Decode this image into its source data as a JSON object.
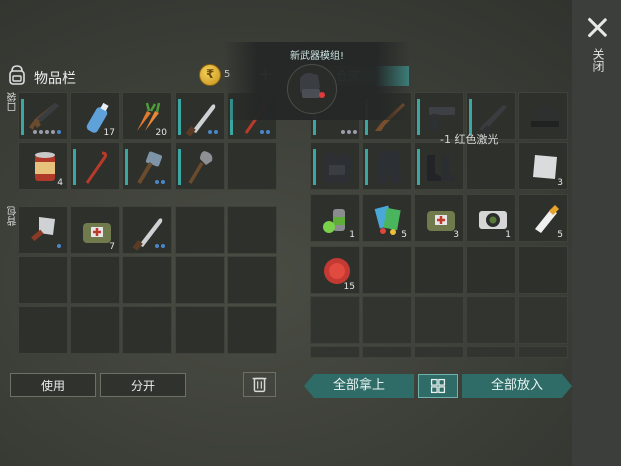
{
  "header": {
    "inventory_title": "物品栏",
    "coins": "5",
    "plus": "+",
    "storage_tab": "仓库",
    "close_label": "关闭"
  },
  "side_labels": {
    "pocket": "口袋",
    "backpack": "背包"
  },
  "popup": {
    "title": "新武器模组!",
    "tooltip": "-1 红色激光"
  },
  "pocket_items": [
    {
      "name": "assault-rifle",
      "count": ""
    },
    {
      "name": "water-bottle",
      "count": "17"
    },
    {
      "name": "carrots",
      "count": "20"
    },
    {
      "name": "machete",
      "count": ""
    },
    {
      "name": "crowbar",
      "count": ""
    },
    {
      "name": "canned-food",
      "count": "4"
    },
    {
      "name": "crowbar",
      "count": ""
    },
    {
      "name": "sledgehammer",
      "count": ""
    },
    {
      "name": "shovel",
      "count": ""
    }
  ],
  "backpack_items": [
    {
      "name": "cleaver",
      "count": ""
    },
    {
      "name": "medkit-bag",
      "count": "7"
    },
    {
      "name": "machete",
      "count": ""
    }
  ],
  "storage_items": [
    {
      "name": "pistol",
      "count": ""
    },
    {
      "name": "shotgun",
      "count": ""
    },
    {
      "name": "pistol",
      "count": ""
    },
    {
      "name": "assault-rifle",
      "count": ""
    },
    {
      "name": "helmet",
      "count": ""
    },
    {
      "name": "tactical-vest",
      "count": ""
    },
    {
      "name": "pants",
      "count": ""
    },
    {
      "name": "boots",
      "count": ""
    },
    {
      "name": "metal-sheet",
      "count": "3"
    },
    {
      "name": "spray-can",
      "count": "1"
    },
    {
      "name": "cards",
      "count": "5"
    },
    {
      "name": "medkit-bag",
      "count": "3"
    },
    {
      "name": "camera",
      "count": "1"
    },
    {
      "name": "glue",
      "count": "5"
    },
    {
      "name": "bottle-cap",
      "count": "15"
    }
  ],
  "buttons": {
    "use": "使用",
    "split": "分开",
    "take_all": "全部拿上",
    "put_all": "全部放入"
  },
  "colors": {
    "accent": "#3aa7a2",
    "teal_button": "#2f6b67",
    "coin": "#e0b130"
  }
}
